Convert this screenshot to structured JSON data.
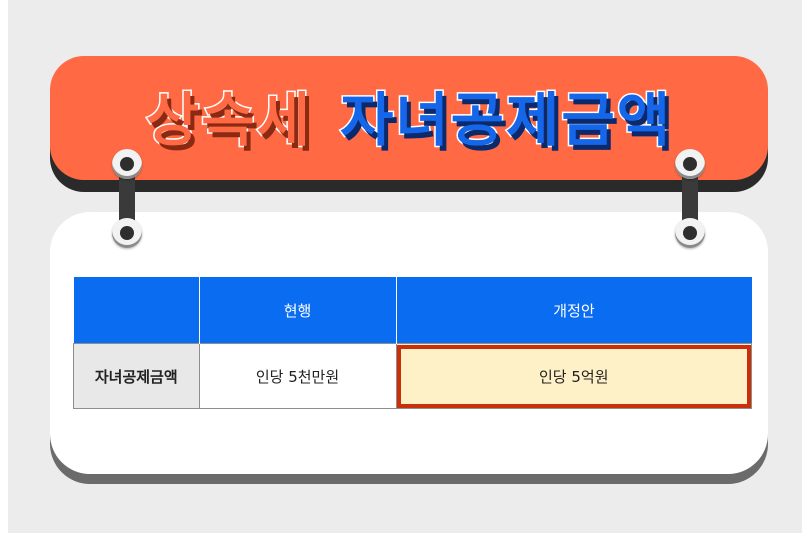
{
  "banner": {
    "title_part1": "상속세",
    "title_part2": "자녀공제금액"
  },
  "table": {
    "headers": [
      "",
      "현행",
      "개정안"
    ],
    "rows": [
      [
        "자녀공제금액",
        "인당 5천만원",
        "인당 5억원"
      ]
    ]
  },
  "colors": {
    "banner": "#ff6a45",
    "header": "#0a6cf1",
    "highlight_fill": "#fff1c7",
    "highlight_border": "#c9300a"
  }
}
